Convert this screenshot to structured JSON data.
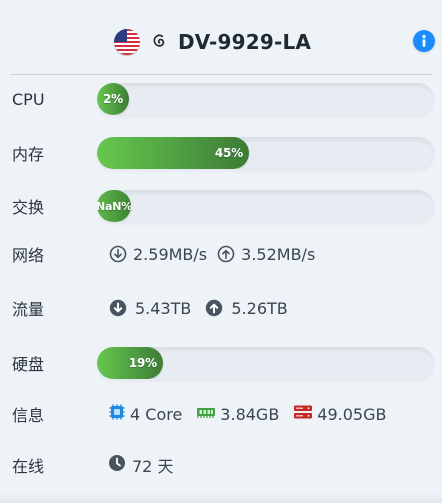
{
  "header": {
    "title": "DV-9929-LA",
    "flag_icon": "us-flag-icon",
    "os_icon": "debian-icon",
    "info_icon": "info-icon",
    "accent": "#1a8cff"
  },
  "stats": {
    "cpu": {
      "label": "CPU",
      "percent_text": "2%",
      "percent": 2
    },
    "memory": {
      "label": "内存",
      "percent_text": "45%",
      "percent": 45
    },
    "swap": {
      "label": "交换",
      "percent_text": "NaN%"
    },
    "network": {
      "label": "网络",
      "down": "2.59MB/s",
      "up": "3.52MB/s"
    },
    "traffic": {
      "label": "流量",
      "down": "5.43TB",
      "up": "5.26TB"
    },
    "disk": {
      "label": "硬盘",
      "percent_text": "19%",
      "percent": 19
    },
    "info": {
      "label": "信息",
      "cpu": "4 Core",
      "memory": "3.84GB",
      "disk": "49.05GB"
    },
    "uptime": {
      "label": "在线",
      "value": "72 天"
    }
  },
  "colors": {
    "progress_fill": "#4f9e43",
    "progress_track": "#e6ecf2",
    "card_bg": "#eef3f8",
    "text": "#2b3440",
    "cpu_icon": "#1e88e5",
    "mem_icon": "#43a047",
    "disk_icon": "#c62828"
  }
}
